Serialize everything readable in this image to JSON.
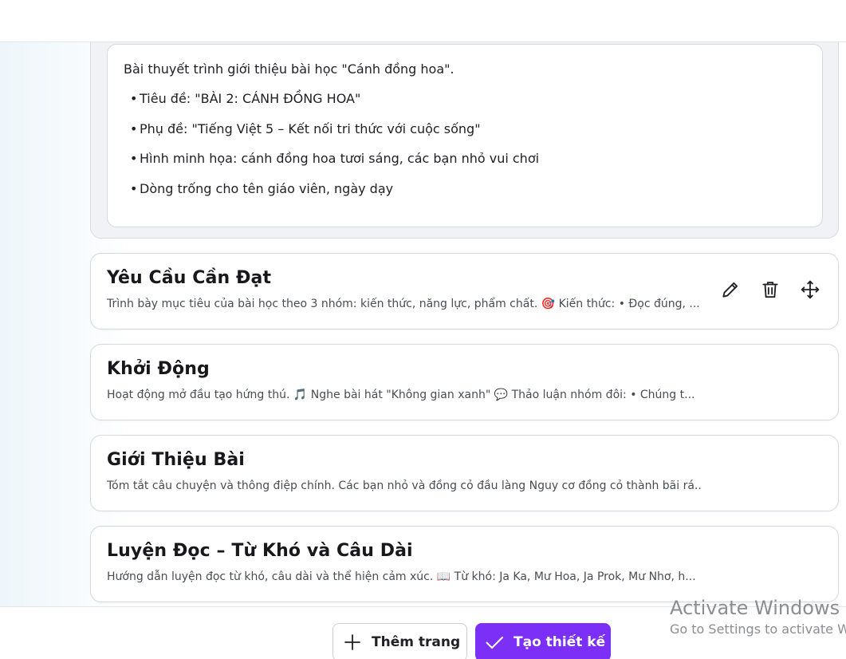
{
  "expanded_card": {
    "intro": "Bài thuyết trình giới thiệu bài học \"Cánh đồng hoa\".",
    "bullets": [
      "Tiêu đề: \"BÀI 2: CÁNH ĐỒNG HOA\"",
      "Phụ đề: \"Tiếng Việt 5 – Kết nối tri thức với cuộc sống\"",
      "Hình minh họa: cánh đồng hoa tươi sáng, các bạn nhỏ vui chơi",
      "Dòng trống cho tên giáo viên, ngày dạy"
    ]
  },
  "cards": [
    {
      "title": "Yêu Cầu Cần Đạt",
      "desc": "Trình bày mục tiêu của bài học theo 3 nhóm: kiến thức, năng lực, phẩm chất. 🎯 Kiến thức: • Đọc đúng, ..."
    },
    {
      "title": "Khởi Động",
      "desc": "Hoạt động mở đầu tạo hứng thú. 🎵 Nghe bài hát \"Không gian xanh\" 💬 Thảo luận nhóm đôi: • Chúng t..."
    },
    {
      "title": "Giới Thiệu Bài",
      "desc": "Tóm tắt câu chuyện và thông điệp chính. Các bạn nhỏ và đồng cỏ đầu làng Nguy cơ đồng cỏ thành bãi rá..."
    },
    {
      "title": "Luyện Đọc – Từ Khó và Câu Dài",
      "desc": "Hướng dẫn luyện đọc từ khó, câu dài và thể hiện cảm xúc. 📖 Từ khó: Ja Ka, Mư Hoa, Ja Prok, Mư Nhơ, h..."
    }
  ],
  "card_actions": {
    "icons": [
      "pencil-icon",
      "trash-icon",
      "move-icon"
    ]
  },
  "bottom_bar": {
    "add_page_label": "Thêm trang",
    "create_design_label": "Tạo thiết kế",
    "accent": "#7b2ff7"
  },
  "watermark": {
    "line1": "Activate Windows",
    "line2": "Go to Settings to activate W"
  }
}
